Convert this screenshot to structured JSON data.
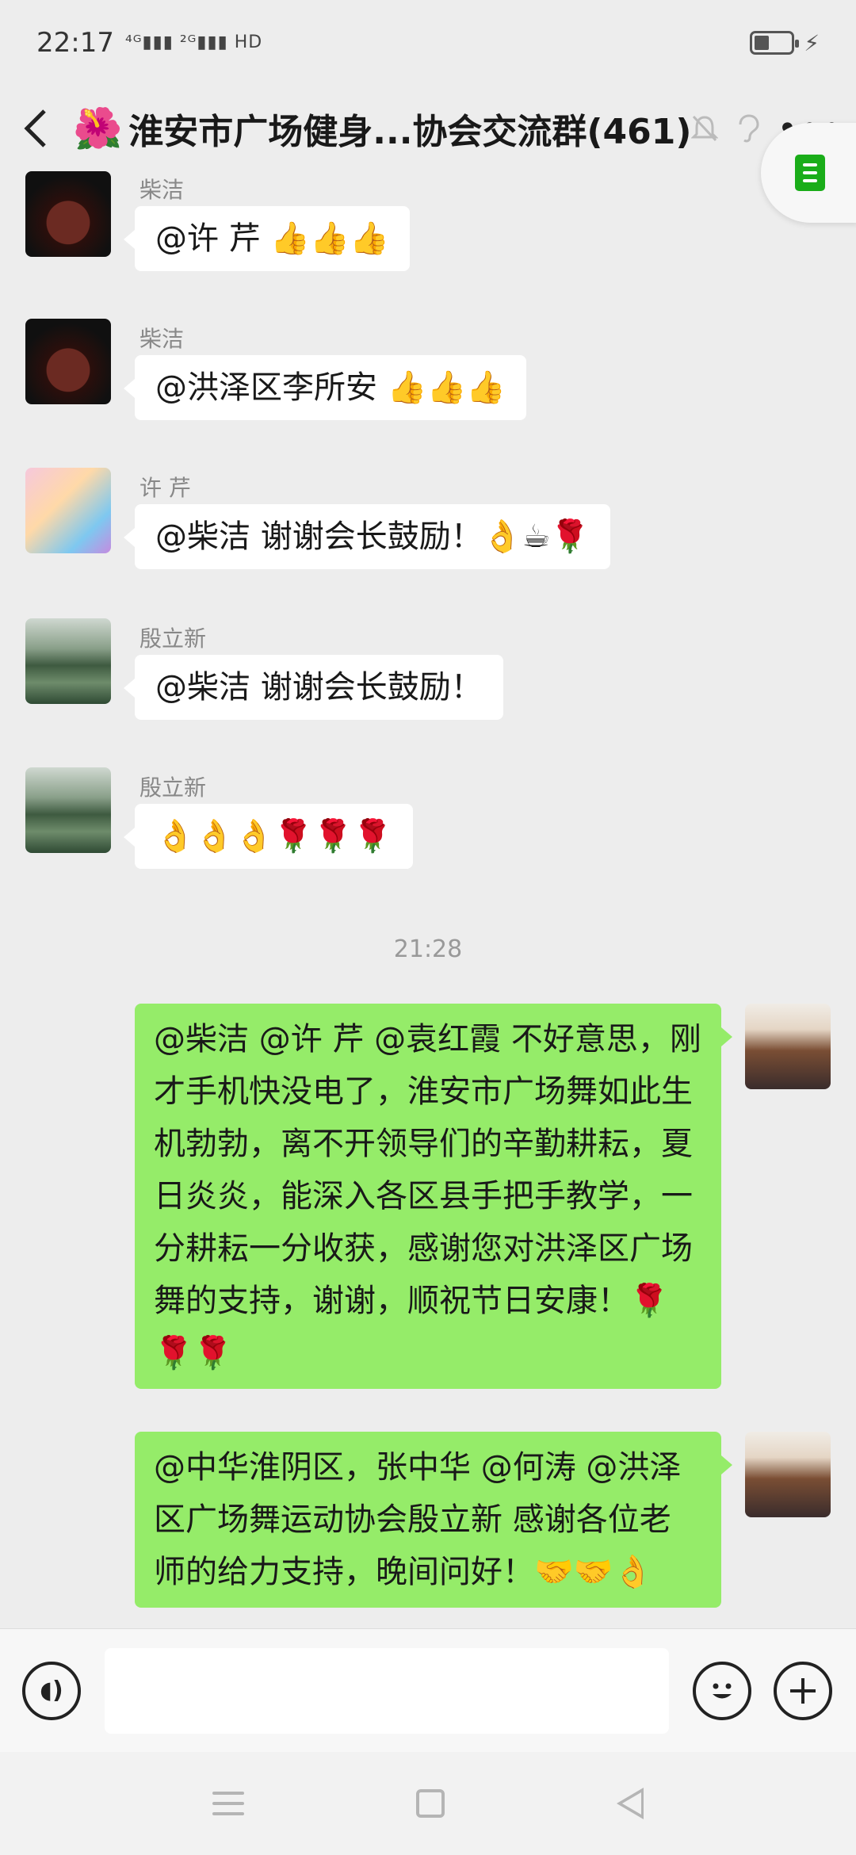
{
  "status_bar": {
    "time": "22:17",
    "signal_text": "⁴ᴳ▮▮▮ ²ᴳ▮▮▮ HD",
    "battery_level": 0.4,
    "charging": true
  },
  "title_bar": {
    "back_icon": "chevron-left-icon",
    "flower": "🌺",
    "title": "淮安市广场健身...协会交流群(461)",
    "mute_icon": "bell-muted-icon",
    "ear_icon": "earpiece-icon",
    "more_icon": "more-icon"
  },
  "doc_tab_icon": "document-icon",
  "messages": [
    {
      "sender": "柴洁",
      "text": "@许  芹 👍👍👍",
      "avatar": "teapot",
      "side": "left"
    },
    {
      "sender": "柴洁",
      "text": "@洪泽区李所安 👍👍👍",
      "avatar": "teapot",
      "side": "left"
    },
    {
      "sender": "许  芹",
      "text": "@柴洁  谢谢会长鼓励！👌☕🌹",
      "avatar": "girl",
      "side": "left"
    },
    {
      "sender": "殷立新",
      "text": "@柴洁  谢谢会长鼓励！",
      "avatar": "lake",
      "side": "left"
    },
    {
      "sender": "殷立新",
      "text": "👌👌👌🌹🌹🌹",
      "avatar": "lake",
      "side": "left"
    },
    {
      "timestamp": "21:28"
    },
    {
      "text": "@柴洁 @许  芹 @袁红霞  不好意思，刚才手机快没电了，淮安市广场舞如此生机勃勃，离不开领导们的辛勤耕耘，夏日炎炎，能深入各区县手把手教学，一分耕耘一分收获，感谢您对洪泽区广场舞的支持，谢谢，顺祝节日安康！🌹🌹🌹",
      "avatar": "man",
      "side": "right"
    },
    {
      "text": "@中华淮阴区，张中华 @何涛 @洪泽区广场舞运动协会殷立新  感谢各位老师的给力支持，晚间问好！🤝🤝👌",
      "avatar": "man",
      "side": "right"
    }
  ],
  "input_bar": {
    "voice_icon": "voice-icon",
    "input_value": "",
    "emoji_icon": "emoji-icon",
    "plus_icon": "plus-icon"
  },
  "nav_bar": {
    "menu_icon": "menu-icon",
    "home_icon": "home-icon",
    "back_icon": "back-triangle-icon"
  },
  "colors": {
    "background": "#ededed",
    "my_bubble": "#95ec69",
    "other_bubble": "#ffffff",
    "accent_green": "#1aad19"
  }
}
